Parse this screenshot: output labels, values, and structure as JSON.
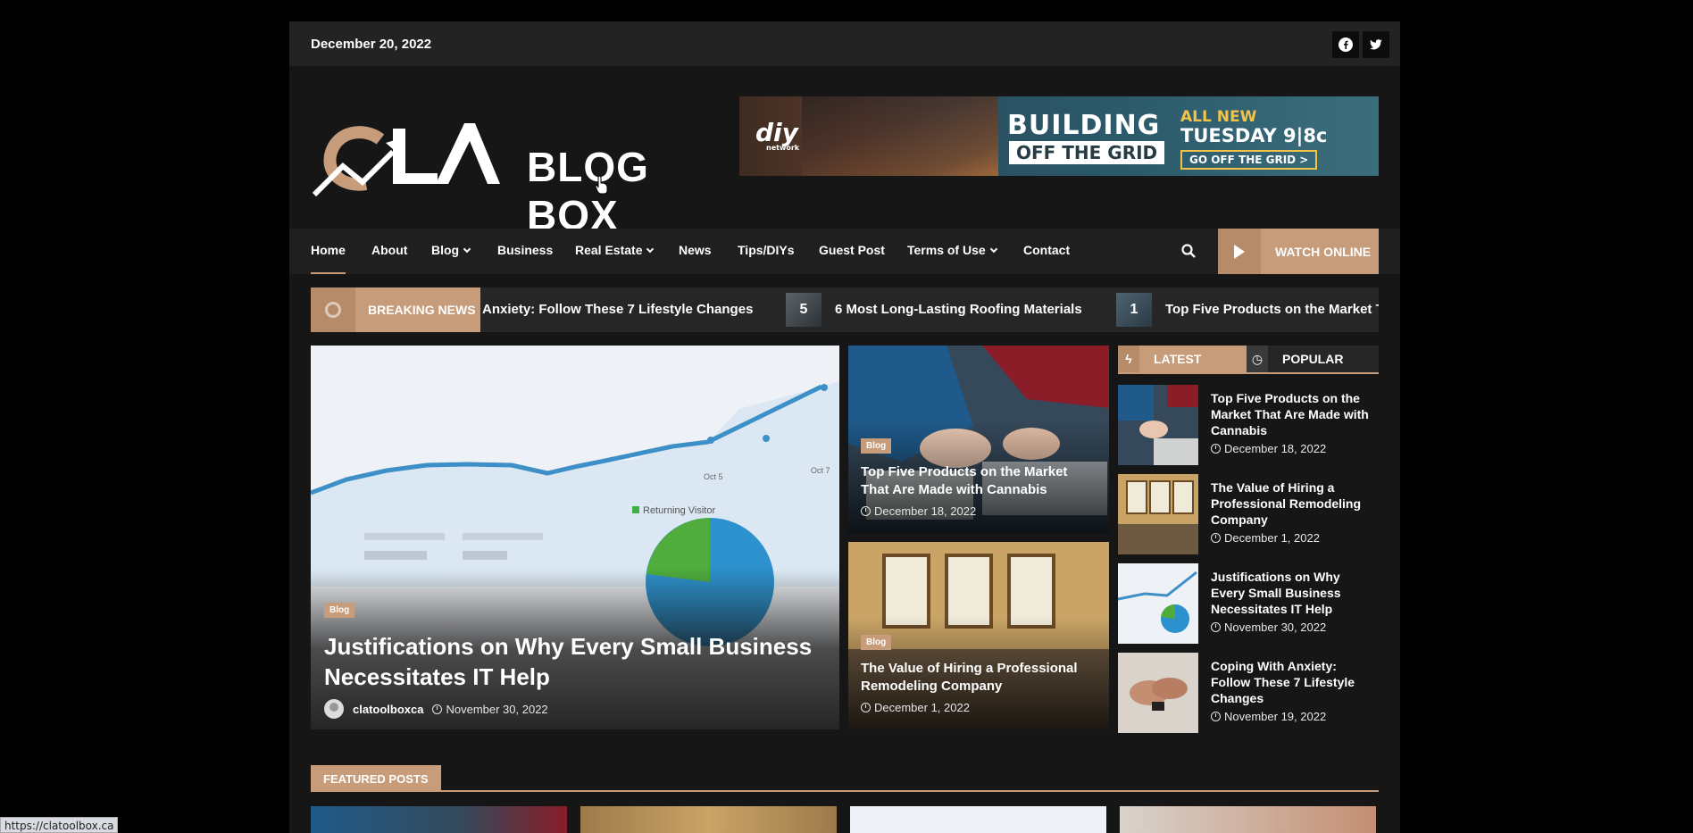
{
  "topbar": {
    "date": "December 20, 2022",
    "social": [
      "facebook-icon",
      "twitter-icon"
    ]
  },
  "header": {
    "logo_text": "BLOG BOX",
    "ad": {
      "brand": "diy",
      "brand_sub": "network",
      "line1": "BUILDING",
      "line2": "OFF THE GRID",
      "all_new": "ALL NEW",
      "time": "TUESDAY 9|8c",
      "cta": "GO OFF THE GRID >"
    }
  },
  "nav": {
    "items": [
      {
        "label": "Home",
        "active": true,
        "dropdown": false
      },
      {
        "label": "About",
        "dropdown": false
      },
      {
        "label": "Blog",
        "dropdown": true
      },
      {
        "label": "Business",
        "dropdown": false
      },
      {
        "label": "Real Estate",
        "dropdown": true
      },
      {
        "label": "News",
        "dropdown": false
      },
      {
        "label": "Tips/DIYs",
        "dropdown": false
      },
      {
        "label": "Guest Post",
        "dropdown": false
      },
      {
        "label": "Terms of Use",
        "dropdown": true
      },
      {
        "label": "Contact",
        "dropdown": false
      }
    ],
    "watch_label": "WATCH ONLINE"
  },
  "breaking": {
    "label": "BREAKING NEWS",
    "items": [
      {
        "text": "Anxiety: Follow These 7 Lifestyle Changes"
      },
      {
        "num": "5",
        "text": "6 Most Long-Lasting Roofing Materials"
      },
      {
        "num": "1",
        "text": "Top Five Products on the Market T"
      }
    ]
  },
  "hero": {
    "category": "Blog",
    "title": "Justifications on Why Every Small Business Necessitates IT Help",
    "author": "clatoolboxca",
    "date": "November 30, 2022",
    "image_text": {
      "x1": "Oct 5",
      "x2": "Oct 7",
      "legend": "Returning Visitor"
    }
  },
  "cards": [
    {
      "category": "Blog",
      "title": "Top Five Products on the Market That Are Made with Cannabis",
      "date": "December 18, 2022"
    },
    {
      "category": "Blog",
      "title": "The Value of Hiring a Professional Remodeling Company",
      "date": "December 1, 2022"
    }
  ],
  "tabs": {
    "latest": "LATEST",
    "popular": "POPULAR"
  },
  "latest": [
    {
      "title": "Top Five Products on the Market That Are Made with Cannabis",
      "date": "December 18, 2022"
    },
    {
      "title": "The Value of Hiring a Professional Remodeling Company",
      "date": "December 1, 2022"
    },
    {
      "title": "Justifications on Why Every Small Business Necessitates IT Help",
      "date": "November 30, 2022"
    },
    {
      "title": "Coping With Anxiety: Follow These 7 Lifestyle Changes",
      "date": "November 19, 2022"
    }
  ],
  "featured": {
    "label": "FEATURED POSTS"
  },
  "status_url": "https://clatoolbox.ca",
  "colors": {
    "accent": "#c69c7a",
    "background": "#161616",
    "panel": "#232323"
  }
}
